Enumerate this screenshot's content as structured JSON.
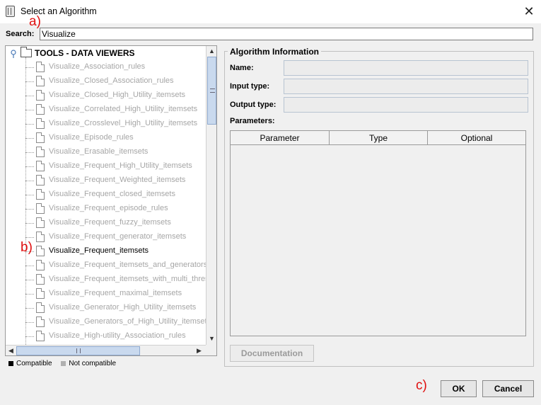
{
  "window": {
    "title": "Select an Algorithm",
    "close_icon": "✕"
  },
  "search": {
    "label": "Search:",
    "value": "Visualize"
  },
  "tree": {
    "root_label": "TOOLS - DATA VIEWERS",
    "items": [
      {
        "label": "Visualize_Association_rules",
        "compatible": false
      },
      {
        "label": "Visualize_Closed_Association_rules",
        "compatible": false
      },
      {
        "label": "Visualize_Closed_High_Utility_itemsets",
        "compatible": false
      },
      {
        "label": "Visualize_Correlated_High_Utility_itemsets",
        "compatible": false
      },
      {
        "label": "Visualize_Crosslevel_High_Utility_itemsets",
        "compatible": false
      },
      {
        "label": "Visualize_Episode_rules",
        "compatible": false
      },
      {
        "label": "Visualize_Erasable_itemsets",
        "compatible": false
      },
      {
        "label": "Visualize_Frequent_High_Utility_itemsets",
        "compatible": false
      },
      {
        "label": "Visualize_Frequent_Weighted_itemsets",
        "compatible": false
      },
      {
        "label": "Visualize_Frequent_closed_itemsets",
        "compatible": false
      },
      {
        "label": "Visualize_Frequent_episode_rules",
        "compatible": false
      },
      {
        "label": "Visualize_Frequent_fuzzy_itemsets",
        "compatible": false
      },
      {
        "label": "Visualize_Frequent_generator_itemsets",
        "compatible": false
      },
      {
        "label": "Visualize_Frequent_itemsets",
        "compatible": true
      },
      {
        "label": "Visualize_Frequent_itemsets_and_generators",
        "compatible": false
      },
      {
        "label": "Visualize_Frequent_itemsets_with_multi_thres",
        "compatible": false
      },
      {
        "label": "Visualize_Frequent_maximal_itemsets",
        "compatible": false
      },
      {
        "label": "Visualize_Generator_High_Utility_itemsets",
        "compatible": false
      },
      {
        "label": "Visualize_Generators_of_High_Utility_itemsets",
        "compatible": false
      },
      {
        "label": "Visualize_High-utility_Association_rules",
        "compatible": false
      }
    ]
  },
  "legend": {
    "compatible": "Compatible",
    "not_compatible": "Not compatible"
  },
  "info": {
    "title": "Algorithm Information",
    "name_label": "Name:",
    "input_label": "Input type:",
    "output_label": "Output type:",
    "params_label": "Parameters:",
    "columns": [
      "Parameter",
      "Type",
      "Optional"
    ],
    "documentation_button": "Documentation"
  },
  "buttons": {
    "ok": "OK",
    "cancel": "Cancel"
  },
  "annotations": {
    "a": "a)",
    "b": "b)",
    "c": "c)"
  },
  "colors": {
    "annotation": "#e01010",
    "incompatible_text": "#a6a6a6",
    "scroll_thumb": "#c9d9ee"
  }
}
